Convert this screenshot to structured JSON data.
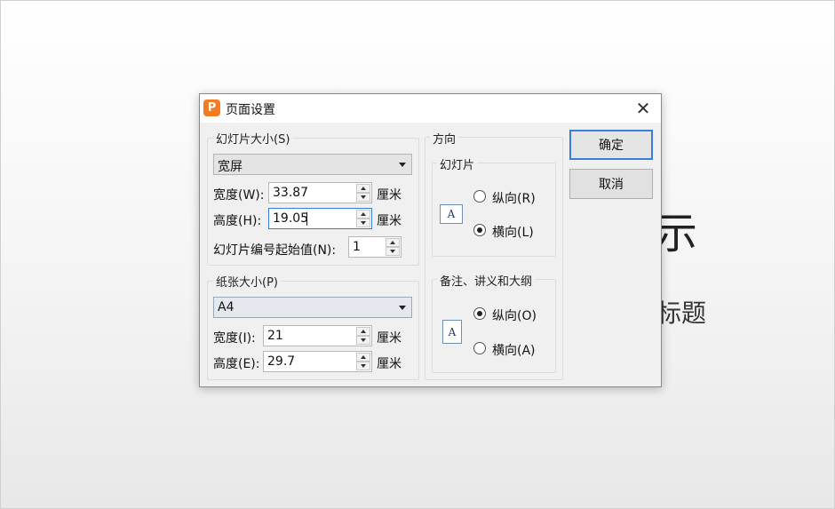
{
  "slide": {
    "title": "示",
    "subtitle": "标题"
  },
  "dialog": {
    "title": "页面设置",
    "app_icon_glyph": "P",
    "close_glyph": "✕",
    "slide_size": {
      "group_label": "幻灯片大小(S)",
      "selected": "宽屏",
      "width_label": "宽度(W):",
      "width_value": "33.87",
      "height_label": "高度(H):",
      "height_value": "19.05",
      "unit": "厘米",
      "start_number_label": "幻灯片编号起始值(N):",
      "start_number_value": "1"
    },
    "paper_size": {
      "group_label": "纸张大小(P)",
      "selected": "A4",
      "width_label": "宽度(I):",
      "width_value": "21",
      "height_label": "高度(E):",
      "height_value": "29.7",
      "unit": "厘米"
    },
    "orientation": {
      "group_label": "方向",
      "slides": {
        "label": "幻灯片",
        "portrait": "纵向(R)",
        "landscape": "横向(L)",
        "selected": "landscape"
      },
      "notes": {
        "label": "备注、讲义和大纲",
        "portrait": "纵向(O)",
        "landscape": "横向(A)",
        "selected": "portrait"
      },
      "page_glyph": "A"
    },
    "buttons": {
      "ok": "确定",
      "cancel": "取消"
    }
  },
  "colors": {
    "app_icon": "#f57b20",
    "focus_border": "#3b7dd8"
  }
}
